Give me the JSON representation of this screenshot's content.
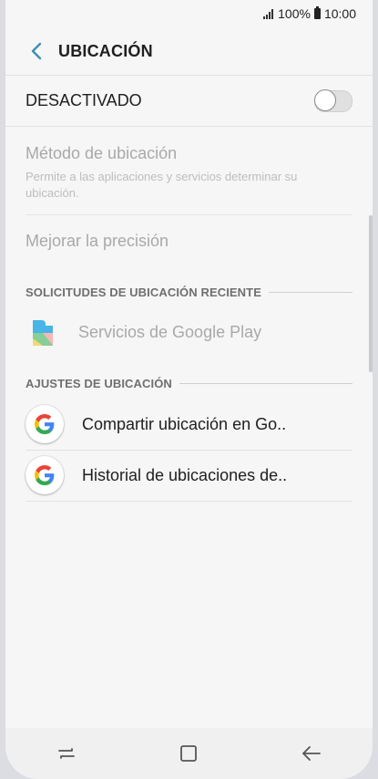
{
  "status": {
    "battery_text": "100%",
    "time": "10:00"
  },
  "header": {
    "title": "UBICACIÓN"
  },
  "master": {
    "label": "DESACTIVADO",
    "enabled": false
  },
  "method": {
    "title": "Método de ubicación",
    "description": "Permite a las aplicaciones y servicios determinar su ubicación."
  },
  "improve": {
    "label": "Mejorar la precisión"
  },
  "recent": {
    "heading": "SOLICITUDES DE UBICACIÓN RECIENTE",
    "items": [
      {
        "label": "Servicios de Google Play",
        "icon": "google-play-services-icon"
      }
    ]
  },
  "settings": {
    "heading": "AJUSTES DE UBICACIÓN",
    "items": [
      {
        "label": "Compartir ubicación en Go..",
        "icon": "google-icon"
      },
      {
        "label": "Historial de ubicaciones de..",
        "icon": "google-icon"
      }
    ]
  },
  "colors": {
    "accent": "#3e8fb5",
    "muted_text": "#a9a9a9"
  }
}
